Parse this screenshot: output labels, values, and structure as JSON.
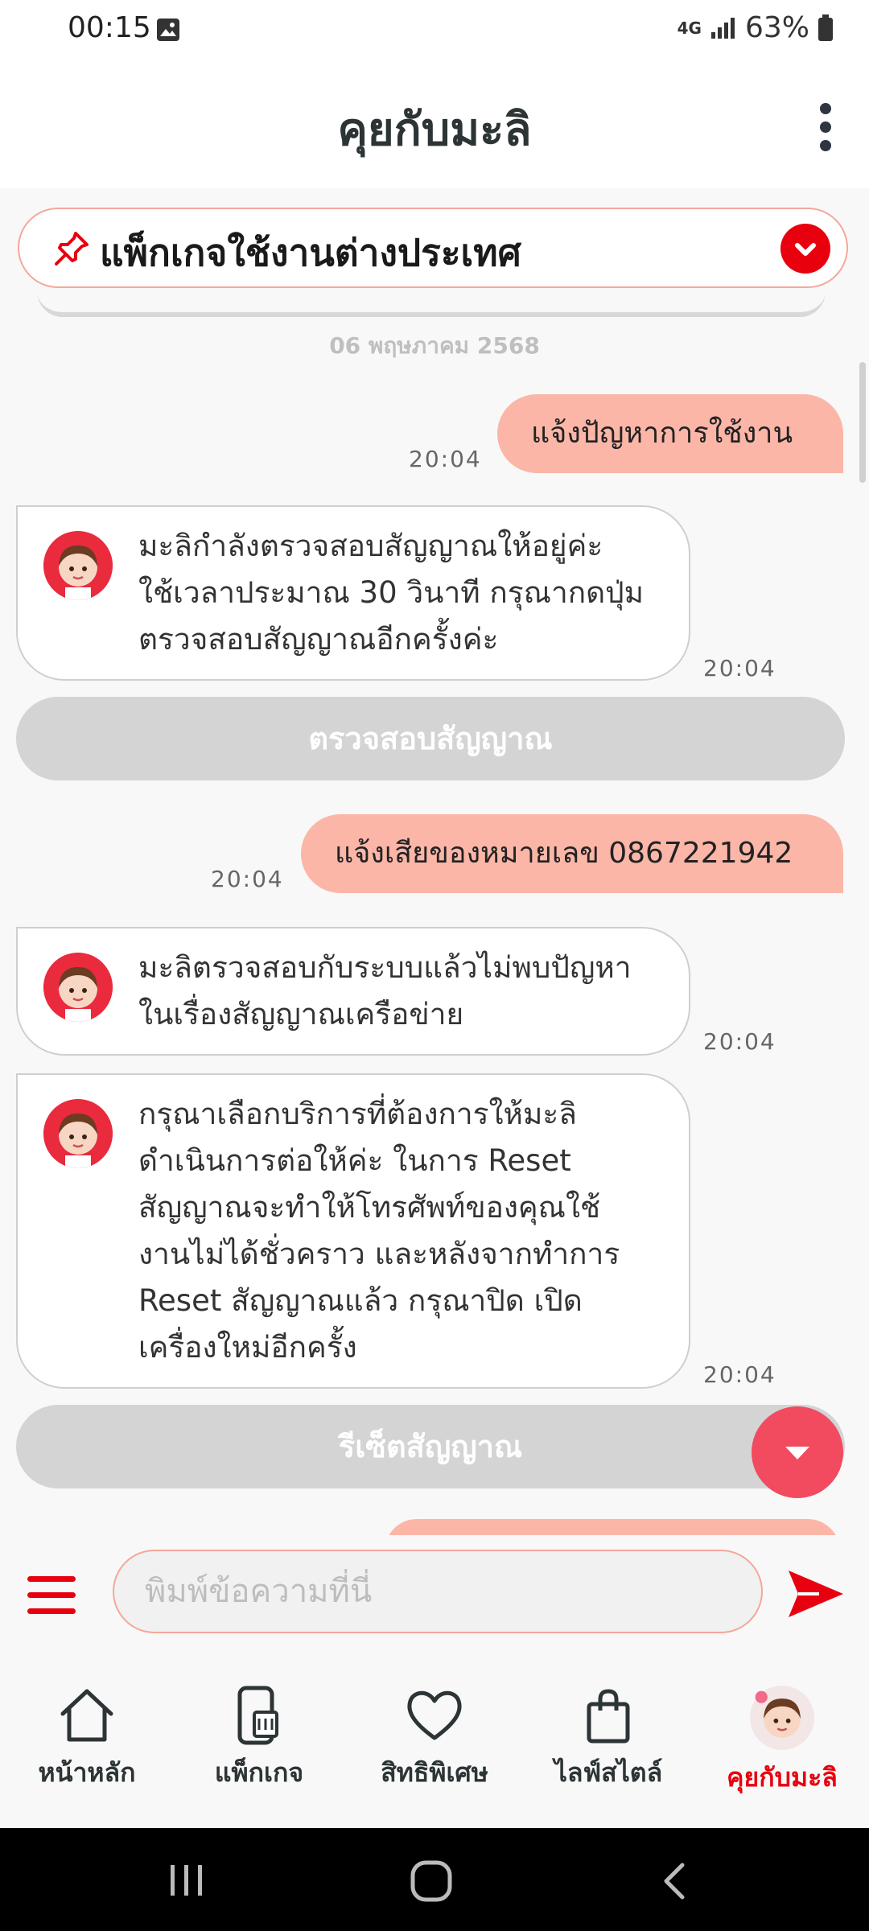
{
  "status_bar": {
    "time": "00:15",
    "network": "4G",
    "battery": "63%"
  },
  "header": {
    "title": "คุยกับมะลิ"
  },
  "pinned": {
    "label": "แพ็กเกจใช้งานต่างประเทศ"
  },
  "chat": {
    "date": "06 พฤษภาคม 2568",
    "m1": {
      "text": "แจ้งปัญหาการใช้งาน",
      "time": "20:04"
    },
    "m2": {
      "lines": [
        "มะลิกำลังตรวจสอบสัญญาณให้อยู่ค่ะ",
        "ใช้เวลาประมาณ 30 วินาที กรุณากดปุ่ม",
        "ตรวจสอบสัญญาณอีกครั้งค่ะ"
      ],
      "time": "20:04"
    },
    "btn1": "ตรวจสอบสัญญาณ",
    "m3": {
      "text": "แจ้งเสียของหมายเลข 0867221942",
      "time": "20:04"
    },
    "m4": {
      "lines": [
        "มะลิตรวจสอบกับระบบแล้วไม่พบปัญหา",
        "ในเรื่องสัญญาณเครือข่าย"
      ],
      "time": "20:04"
    },
    "m5": {
      "lines": [
        "กรุณาเลือกบริการที่ต้องการให้มะลิ",
        "ดำเนินการต่อให้ค่ะ ในการ Reset",
        "สัญญาณจะทำให้โทรศัพท์ของคุณใช้",
        "งานไม่ได้ชั่วคราว และหลังจากทำการ",
        "Reset สัญญาณแล้ว กรุณาปิด เปิด",
        "เครื่องใหม่อีกครั้ง"
      ],
      "time": "20:04"
    },
    "btn2": "รีเซ็ตสัญญาณ"
  },
  "input": {
    "placeholder": "พิมพ์ข้อความที่นี่"
  },
  "tabs": [
    {
      "label": "หน้าหลัก",
      "icon": "home-icon"
    },
    {
      "label": "แพ็กเกจ",
      "icon": "sim-phone-icon"
    },
    {
      "label": "สิทธิพิเศษ",
      "icon": "heart-icon"
    },
    {
      "label": "ไลฟ์สไตล์",
      "icon": "shopping-bag-icon"
    },
    {
      "label": "คุยกับมะลิ",
      "icon": "mali-avatar-icon",
      "active": true
    }
  ],
  "colors": {
    "accent": "#e8000f",
    "user_bubble": "#fbb6a8",
    "fab": "#f24a5e"
  }
}
